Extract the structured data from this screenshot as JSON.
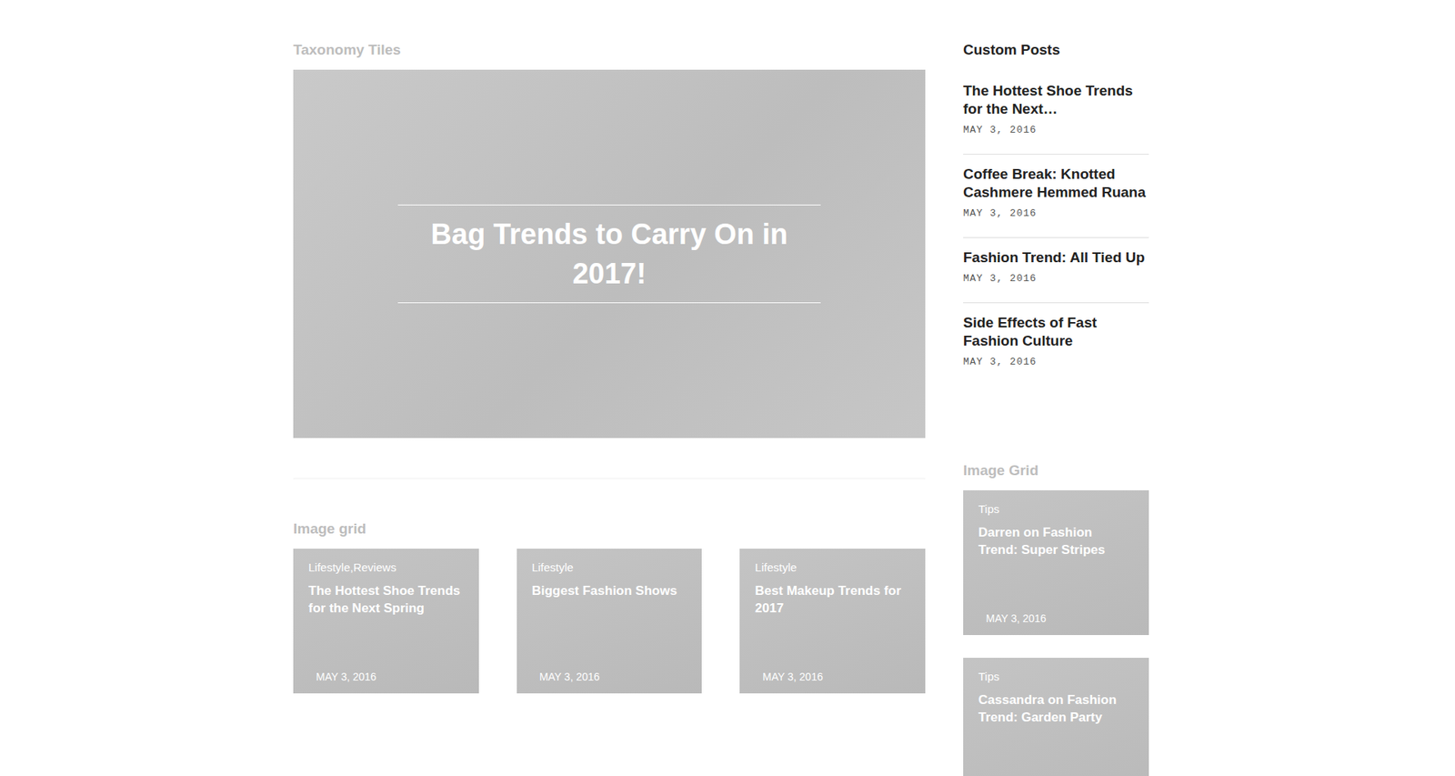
{
  "main": {
    "taxonomy": {
      "heading": "Taxonomy Tiles",
      "tile_title": "Bag Trends to Carry On in 2017!"
    },
    "image_grid": {
      "heading": "Image grid",
      "cards": [
        {
          "category": "Lifestyle,Reviews",
          "title": "The Hottest Shoe Trends for the Next Spring",
          "date": "MAY 3, 2016"
        },
        {
          "category": "Lifestyle",
          "title": "Biggest Fashion Shows",
          "date": "MAY 3, 2016"
        },
        {
          "category": "Lifestyle",
          "title": "Best Makeup Trends for 2017",
          "date": "MAY 3, 2016"
        }
      ]
    }
  },
  "sidebar": {
    "custom_posts": {
      "heading": "Custom Posts",
      "posts": [
        {
          "title": "The Hottest Shoe Trends for the Next…",
          "date": "MAY 3, 2016"
        },
        {
          "title": "Coffee Break: Knotted Cashmere Hemmed Ruana",
          "date": "MAY 3, 2016"
        },
        {
          "title": "Fashion Trend: All Tied Up",
          "date": "MAY 3, 2016"
        },
        {
          "title": "Side Effects of Fast Fashion Culture",
          "date": "MAY 3, 2016"
        }
      ]
    },
    "image_grid": {
      "heading": "Image Grid",
      "cards": [
        {
          "category": "Tips",
          "title": "Darren on Fashion Trend: Super Stripes",
          "date": "MAY 3, 2016"
        },
        {
          "category": "Tips",
          "title": "Cassandra on Fashion Trend: Garden Party",
          "date": ""
        }
      ]
    }
  }
}
